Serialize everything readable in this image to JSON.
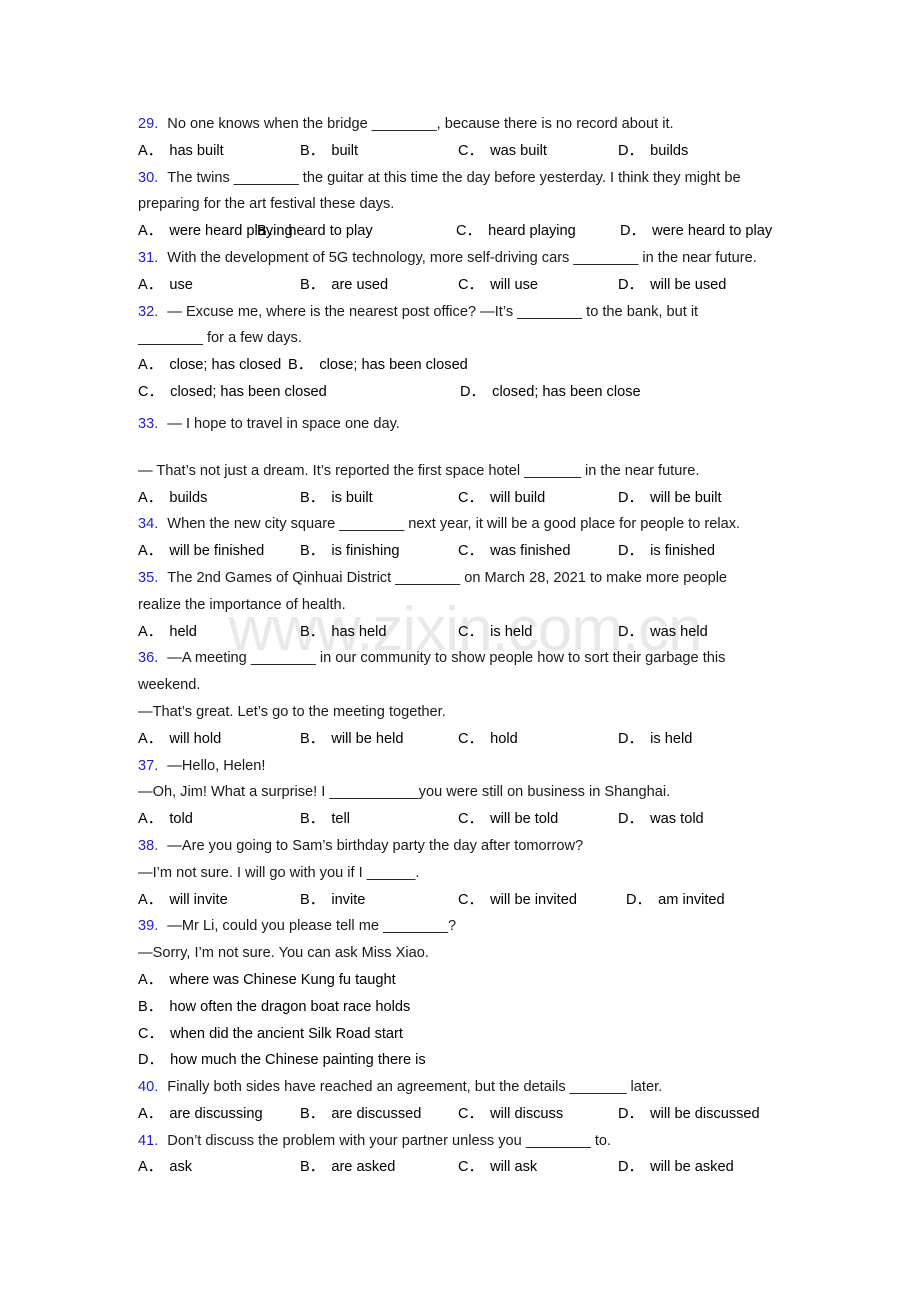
{
  "document": {
    "type": "english-grammar-worksheet",
    "watermark": "www.zixin.com.cn",
    "number_color": "#2222CC",
    "text_color": "#1A1A1A",
    "background": "#FFFFFF"
  },
  "questions": [
    {
      "number": "29.",
      "stem": "No one knows when the bridge ________, because there is no record about it.",
      "layout": "cols4",
      "options": [
        {
          "letter": "A．",
          "text": "has built"
        },
        {
          "letter": "B．",
          "text": "built"
        },
        {
          "letter": "C．",
          "text": "was built"
        },
        {
          "letter": "D．",
          "text": "builds"
        }
      ]
    },
    {
      "number": "30.",
      "stem_line1": "The twins ________ the guitar at this time the day before yesterday. I think they might be",
      "stem_line2": "preparing for the art festival these days.",
      "layout": "cols4-tight",
      "options": [
        {
          "letter": "A．",
          "text": "were heard playing"
        },
        {
          "letter": "B．",
          "text": "heard to play"
        },
        {
          "letter": "C．",
          "text": "heard playing"
        },
        {
          "letter": "D．",
          "text": "were heard to play"
        }
      ]
    },
    {
      "number": "31.",
      "stem": "With the development of 5G technology, more self-driving cars ________ in the near future.",
      "layout": "cols4",
      "options": [
        {
          "letter": "A．",
          "text": "use"
        },
        {
          "letter": "B．",
          "text": "are used"
        },
        {
          "letter": "C．",
          "text": "will use"
        },
        {
          "letter": "D．",
          "text": "will be used"
        }
      ]
    },
    {
      "number": "32.",
      "stem_line1": "— Excuse me, where is the nearest post office?  —It’s ________ to the bank, but it",
      "stem_line2": "________ for a few days.",
      "layout": "two-by-two",
      "options": [
        {
          "letter": "A．",
          "text": "close; has closed"
        },
        {
          "letter": "B．",
          "text": "close; has been closed"
        },
        {
          "letter": "C．",
          "text": "closed; has been closed"
        },
        {
          "letter": "D．",
          "text": "closed; has been close"
        }
      ]
    },
    {
      "number": "33.",
      "stem_line1": "— I hope to travel in space one day.",
      "stem_line2": "— That’s not just a dream. It’s reported the first space hotel _______ in the near future.",
      "layout": "cols4",
      "options": [
        {
          "letter": "A．",
          "text": "builds"
        },
        {
          "letter": "B．",
          "text": "is built"
        },
        {
          "letter": "C．",
          "text": "will build"
        },
        {
          "letter": "D．",
          "text": "will be built"
        }
      ]
    },
    {
      "number": "34.",
      "stem": "When the new city square ________ next year, it will be a good place for people to relax.",
      "layout": "cols4",
      "options": [
        {
          "letter": "A．",
          "text": "will be finished"
        },
        {
          "letter": "B．",
          "text": "is finishing"
        },
        {
          "letter": "C．",
          "text": "was finished"
        },
        {
          "letter": "D．",
          "text": "is finished"
        }
      ]
    },
    {
      "number": "35.",
      "stem_line1": "The 2nd Games of Qinhuai District ________ on March 28, 2021 to make more people",
      "stem_line2": "realize the importance of health.",
      "layout": "cols4",
      "options": [
        {
          "letter": "A．",
          "text": "held"
        },
        {
          "letter": "B．",
          "text": "has held"
        },
        {
          "letter": "C．",
          "text": "is held"
        },
        {
          "letter": "D．",
          "text": "was held"
        }
      ]
    },
    {
      "number": "36.",
      "stem_line1": "—A meeting ________ in our community to show people how to sort their garbage this",
      "stem_line2": "weekend.",
      "stem_line3": "—That’s great. Let’s go to the meeting together.",
      "layout": "cols4",
      "options": [
        {
          "letter": "A．",
          "text": "will hold"
        },
        {
          "letter": "B．",
          "text": "will be held"
        },
        {
          "letter": "C．",
          "text": "hold"
        },
        {
          "letter": "D．",
          "text": "is held"
        }
      ]
    },
    {
      "number": "37.",
      "stem_line1": "—Hello, Helen!",
      "stem_line2": "—Oh, Jim! What a surprise! I ___________you were still on business in Shanghai.",
      "layout": "cols4",
      "options": [
        {
          "letter": "A．",
          "text": "told"
        },
        {
          "letter": "B．",
          "text": "tell"
        },
        {
          "letter": "C．",
          "text": "will be told"
        },
        {
          "letter": "D．",
          "text": "was told"
        }
      ]
    },
    {
      "number": "38.",
      "stem_line1": "—Are you going to Sam’s birthday party the day after tomorrow?",
      "stem_line2": "—I’m not sure. I will go with you if I ______.",
      "layout": "cols4",
      "options": [
        {
          "letter": "A．",
          "text": "will invite"
        },
        {
          "letter": "B．",
          "text": "invite"
        },
        {
          "letter": "C．",
          "text": "will be invited"
        },
        {
          "letter": "D．",
          "text": "am invited"
        }
      ]
    },
    {
      "number": "39.",
      "stem_line1": "—Mr Li, could you please tell me ________?",
      "stem_line2": "—Sorry, I’m not sure. You can ask Miss Xiao.",
      "layout": "stacked",
      "options": [
        {
          "letter": "A．",
          "text": "where was Chinese Kung fu taught"
        },
        {
          "letter": "B．",
          "text": "how often the dragon boat race holds"
        },
        {
          "letter": "C．",
          "text": "when did the ancient Silk Road start"
        },
        {
          "letter": "D．",
          "text": "how much the Chinese painting there is"
        }
      ]
    },
    {
      "number": "40.",
      "stem": "Finally both sides have reached an agreement, but the details _______ later.",
      "layout": "cols4",
      "options": [
        {
          "letter": "A．",
          "text": "are discussing"
        },
        {
          "letter": "B．",
          "text": "are discussed"
        },
        {
          "letter": "C．",
          "text": "will discuss"
        },
        {
          "letter": "D．",
          "text": "will be discussed"
        }
      ]
    },
    {
      "number": "41.",
      "stem": "Don’t discuss the problem with your partner unless you ________ to.",
      "layout": "cols4",
      "options": [
        {
          "letter": "A．",
          "text": "ask"
        },
        {
          "letter": "B．",
          "text": "are asked"
        },
        {
          "letter": "C．",
          "text": "will ask"
        },
        {
          "letter": "D．",
          "text": "will be asked"
        }
      ]
    }
  ]
}
